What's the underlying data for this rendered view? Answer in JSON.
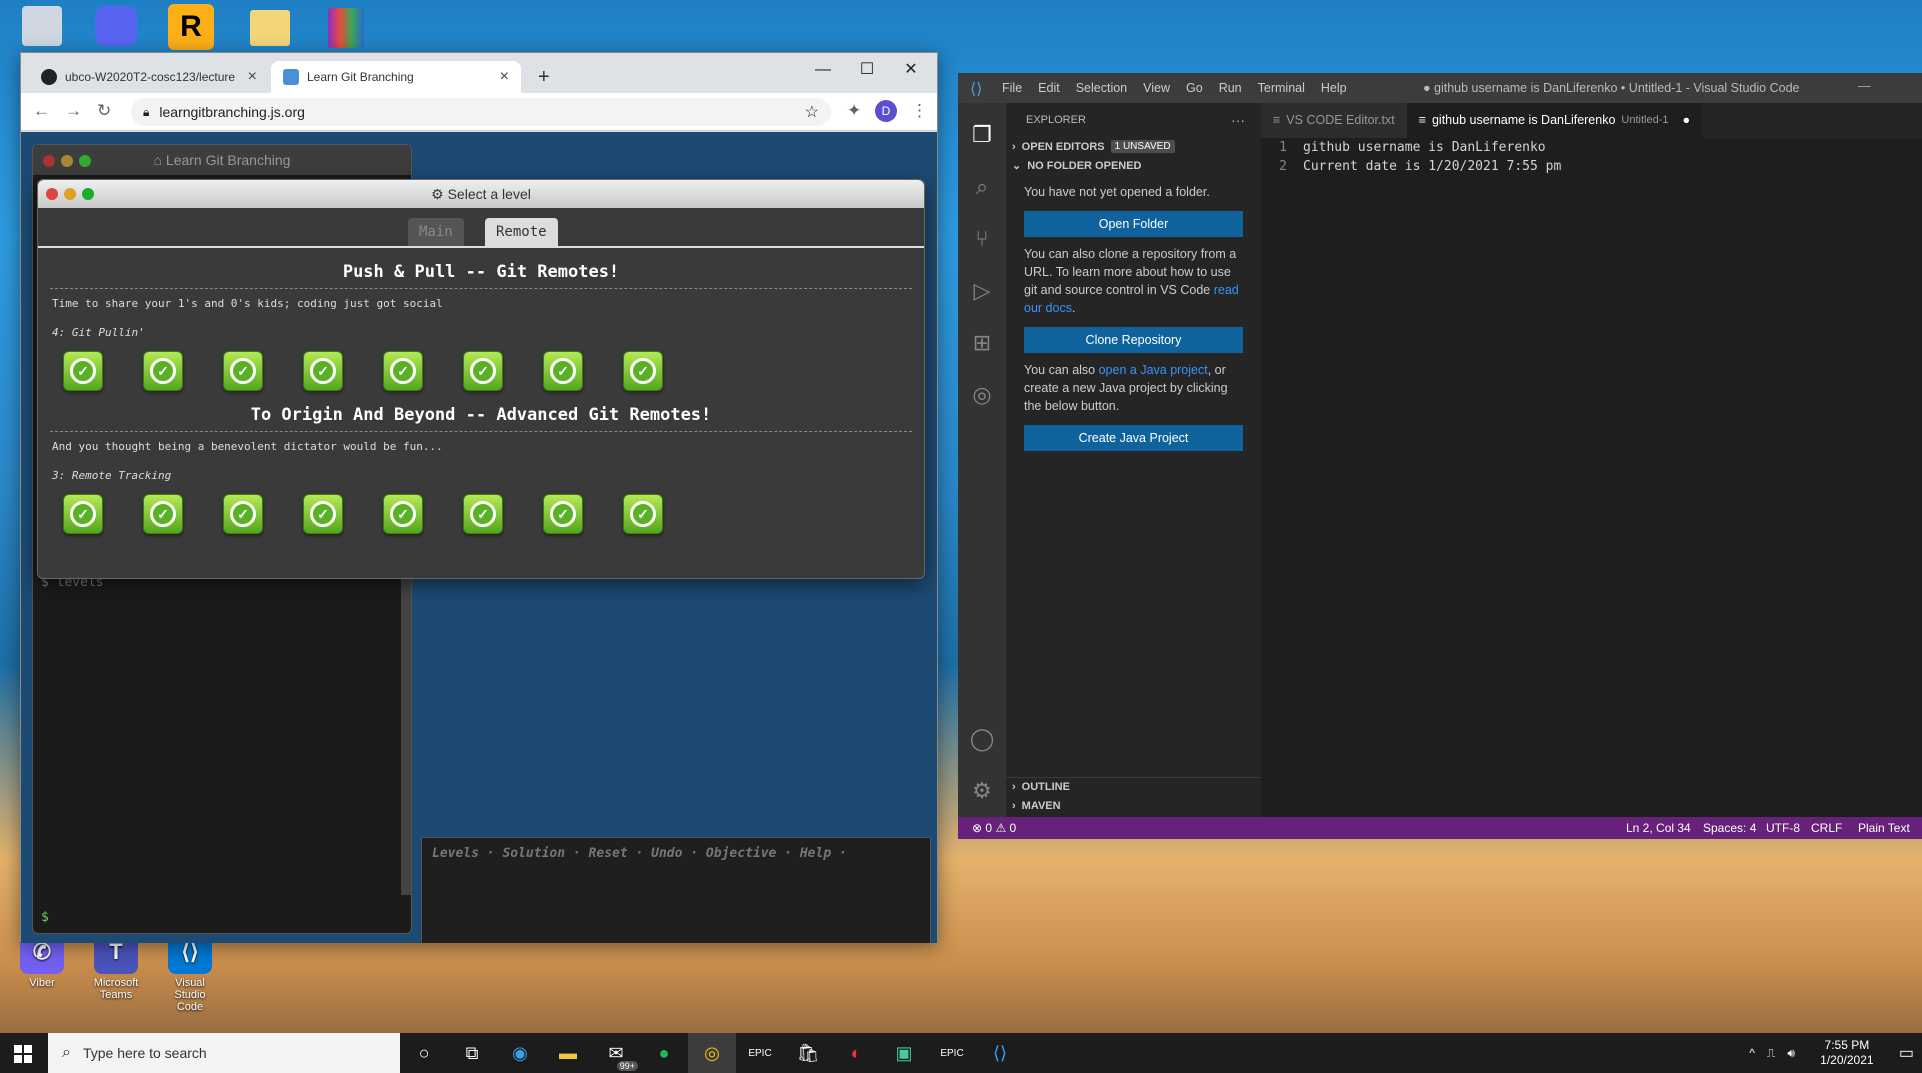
{
  "desktop": {
    "icons": [
      {
        "label": "Viber",
        "color": "#7360f2"
      },
      {
        "label": "Microsoft Teams",
        "color": "#4b53bc"
      },
      {
        "label": "Visual Studio Code",
        "color": "#0078d4"
      }
    ]
  },
  "chrome": {
    "tabs": [
      {
        "title": "ubco-W2020T2-cosc123/lecture",
        "icon": "github-icon"
      },
      {
        "title": "Learn Git Branching",
        "icon": "lgb-icon"
      }
    ],
    "url": "learngitbranching.js.org",
    "profile_initial": "D",
    "lgb": {
      "window_title": "Learn Git Branching",
      "levels_prompt": "levels",
      "shell_prompt": "$",
      "command_links": "Levels · Solution · Reset · Undo · Objective · Help ·",
      "dialog": {
        "title": "Select a level",
        "tab_main": "Main",
        "tab_remote": "Remote",
        "sections": [
          {
            "title": "Push & Pull -- Git Remotes!",
            "description": "Time to share your 1's and 0's kids; coding just got social",
            "sub": "4: Git Pullin'",
            "level_count": 8
          },
          {
            "title": "To Origin And Beyond -- Advanced Git Remotes!",
            "description": "And you thought being a benevolent dictator would be fun...",
            "sub": "3: Remote Tracking",
            "level_count": 8
          }
        ]
      }
    }
  },
  "vscode": {
    "menu": [
      "File",
      "Edit",
      "Selection",
      "View",
      "Go",
      "Run",
      "Terminal",
      "Help"
    ],
    "window_title": "● github username is DanLiferenko • Untitled-1 - Visual Studio Code",
    "explorer": {
      "heading": "EXPLORER",
      "open_editors": "OPEN EDITORS",
      "unsaved_badge": "1 UNSAVED",
      "no_folder": "NO FOLDER OPENED",
      "not_opened_text": "You have not yet opened a folder.",
      "open_folder_button": "Open Folder",
      "clone_text_a": "You can also clone a repository from a URL. To learn more about how to use git and source control in VS Code ",
      "clone_link": "read our docs",
      "clone_text_b": ".",
      "clone_button": "Clone Repository",
      "java_text_a": "You can also ",
      "java_link": "open a Java project",
      "java_text_b": ", or create a new Java project by clicking the below button.",
      "java_button": "Create Java Project",
      "outline": "OUTLINE",
      "maven": "MAVEN"
    },
    "tabs": [
      {
        "label": "VS CODE Editor.txt",
        "active": false
      },
      {
        "label": "github username is DanLiferenko",
        "suffix": "Untitled-1",
        "active": true
      }
    ],
    "lines": [
      {
        "n": "1",
        "text": "github username is DanLiferenko"
      },
      {
        "n": "2",
        "text": "Current date is 1/20/2021 7:55 pm"
      }
    ],
    "status": {
      "errors": "0",
      "warnings": "0",
      "position": "Ln 2, Col 34",
      "spaces": "Spaces: 4",
      "encoding": "UTF-8",
      "eol": "CRLF",
      "language": "Plain Text"
    }
  },
  "taskbar": {
    "search_placeholder": "Type here to search",
    "mail_badge": "99+",
    "time": "7:55 PM",
    "date": "1/20/2021"
  }
}
